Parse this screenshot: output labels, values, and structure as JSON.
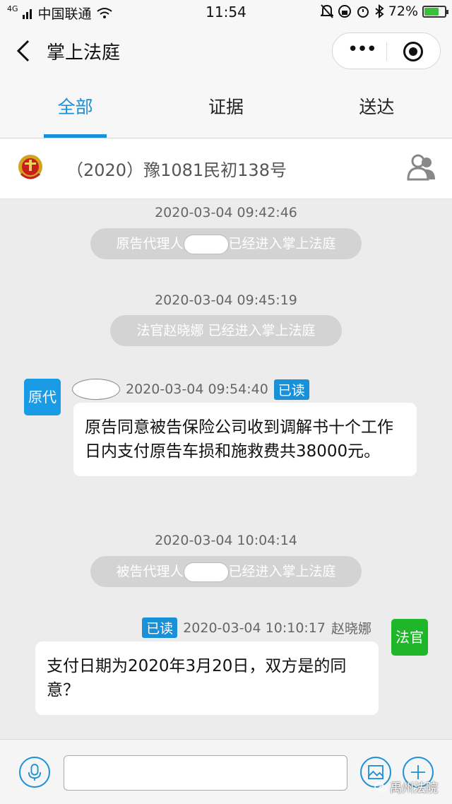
{
  "status_bar": {
    "network": "4G",
    "carrier": "中国联通",
    "time": "11:54",
    "battery_text": "72%",
    "battery_level": 0.72
  },
  "header": {
    "title": "掌上法庭",
    "more_icon": "more-dots-icon",
    "close_icon": "target-icon"
  },
  "tabs": [
    {
      "label": "全部",
      "active": true
    },
    {
      "label": "证据",
      "active": false
    },
    {
      "label": "送达",
      "active": false
    }
  ],
  "case": {
    "number": "（2020）豫1081民初138号"
  },
  "messages": {
    "ts1": "2020-03-04 09:42:46",
    "sys1_prefix": "原告代理人",
    "sys1_suffix": "已经进入掌上法庭",
    "ts2": "2020-03-04 09:45:19",
    "sys2": "法官赵晓娜 已经进入掌上法庭",
    "msg1_avatar": "原代",
    "msg1_time": "2020-03-04 09:54:40",
    "msg1_read": "已读",
    "msg1_text": "原告同意被告保险公司收到调解书十个工作日内支付原告车损和施救费共38000元。",
    "ts3": "2020-03-04 10:04:14",
    "sys3_prefix": "被告代理人",
    "sys3_suffix": "已经进入掌上法庭",
    "msg2_read": "已读",
    "msg2_time": "2020-03-04 10:10:17",
    "msg2_name": "赵晓娜",
    "msg2_avatar": "法官",
    "msg2_text": "支付日期为2020年3月20日，双方是的同意？"
  },
  "composer": {
    "input_value": "",
    "watermark": "禹州法院"
  },
  "colors": {
    "accent": "#1a90d8",
    "judge": "#20b62a",
    "plaintiff": "#1a9be6"
  }
}
